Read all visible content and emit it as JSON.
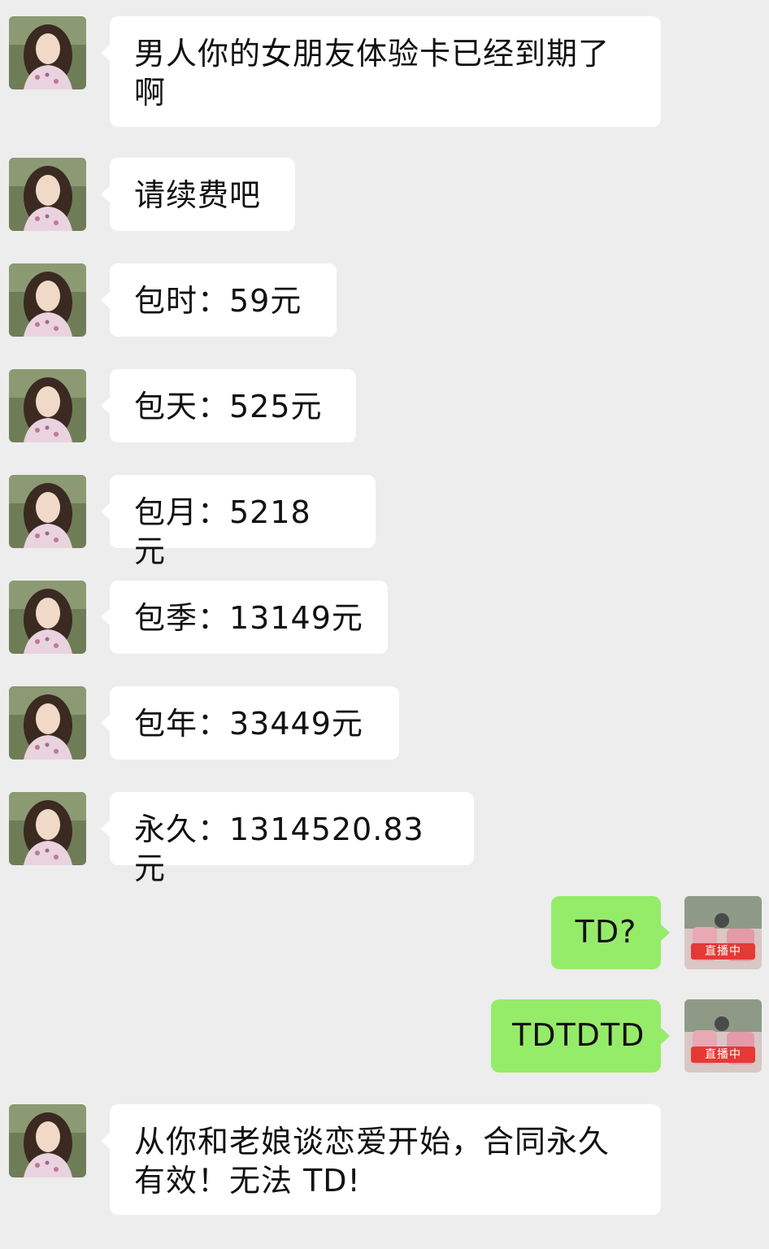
{
  "colors": {
    "background": "#ededed",
    "incoming_bubble": "#ffffff",
    "outgoing_bubble": "#95ec69",
    "live_badge": "#e53935"
  },
  "messages": [
    {
      "side": "left",
      "avatar": "female-profile-photo",
      "text": "男人你的女朋友体验卡已经到期了啊"
    },
    {
      "side": "left",
      "avatar": "female-profile-photo",
      "text": "请续费吧"
    },
    {
      "side": "left",
      "avatar": "female-profile-photo",
      "text": "包时：59元"
    },
    {
      "side": "left",
      "avatar": "female-profile-photo",
      "text": "包天：525元"
    },
    {
      "side": "left",
      "avatar": "female-profile-photo",
      "text": "包月：5218 元"
    },
    {
      "side": "left",
      "avatar": "female-profile-photo",
      "text": "包季：13149元"
    },
    {
      "side": "left",
      "avatar": "female-profile-photo",
      "text": "包年：33449元"
    },
    {
      "side": "left",
      "avatar": "female-profile-photo",
      "text": "永久：1314520.83元"
    },
    {
      "side": "right",
      "avatar": "live-stream-photo",
      "text": "TD?",
      "badge": "直播中"
    },
    {
      "side": "right",
      "avatar": "live-stream-photo",
      "text": "TDTDTD",
      "badge": "直播中"
    },
    {
      "side": "left",
      "avatar": "female-profile-photo",
      "text": "从你和老娘谈恋爱开始，合同永久有效！无法 TD!"
    }
  ]
}
